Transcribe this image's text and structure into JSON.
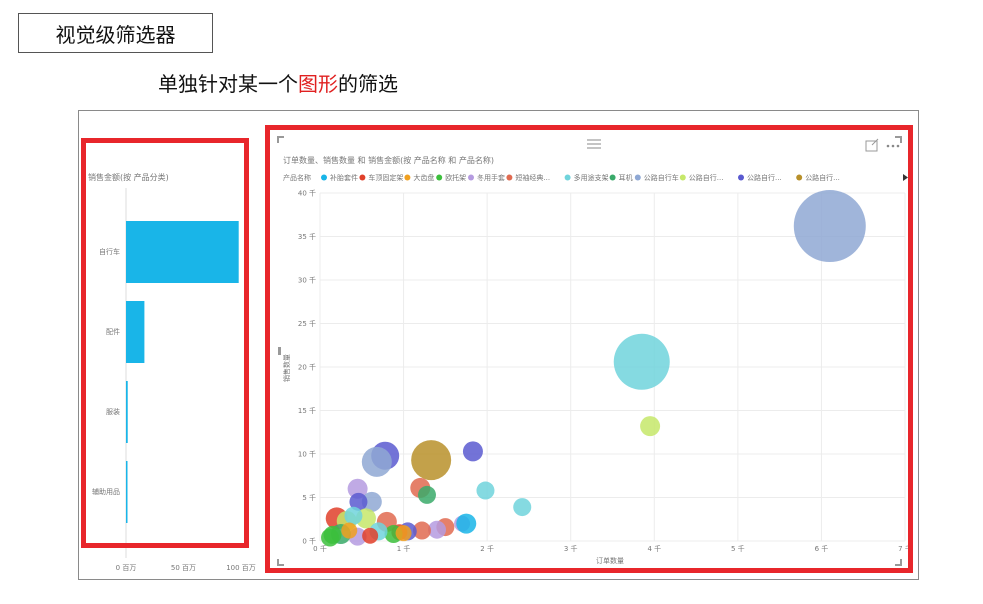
{
  "page": {
    "box_title": "视觉级筛选器",
    "subtitle_pre": "单独针对某一个",
    "subtitle_highlight": "图形",
    "subtitle_post": "的筛选"
  },
  "chart_data": [
    {
      "type": "bar",
      "orientation": "horizontal",
      "title": "销售金额(按 产品分类)",
      "categories": [
        "自行车",
        "配件",
        "服装",
        "辅助用品"
      ],
      "values": [
        98,
        16,
        1.5,
        1
      ],
      "xlim": [
        0,
        100
      ],
      "xticks": [
        {
          "v": 0,
          "label": "0 百万"
        },
        {
          "v": 50,
          "label": "50 百万"
        },
        {
          "v": 100,
          "label": "100 百万"
        }
      ],
      "color": "#19b5e8"
    },
    {
      "type": "scatter",
      "title": "订单数量、销售数量 和 销售金额(按 产品名称 和 产品名称)",
      "xlabel": "订单数量",
      "ylabel": "销售数量",
      "xlim": [
        0,
        7000
      ],
      "ylim": [
        0,
        40000
      ],
      "xticks": [
        {
          "v": 0,
          "label": "0 千"
        },
        {
          "v": 1000,
          "label": "1 千"
        },
        {
          "v": 2000,
          "label": "2 千"
        },
        {
          "v": 3000,
          "label": "3 千"
        },
        {
          "v": 4000,
          "label": "4 千"
        },
        {
          "v": 5000,
          "label": "5 千"
        },
        {
          "v": 6000,
          "label": "6 千"
        },
        {
          "v": 7000,
          "label": "7 千"
        }
      ],
      "yticks": [
        {
          "v": 0,
          "label": "0 千"
        },
        {
          "v": 5000,
          "label": "5 千"
        },
        {
          "v": 10000,
          "label": "10 千"
        },
        {
          "v": 15000,
          "label": "15 千"
        },
        {
          "v": 20000,
          "label": "20 千"
        },
        {
          "v": 25000,
          "label": "25 千"
        },
        {
          "v": 30000,
          "label": "30 千"
        },
        {
          "v": 35000,
          "label": "35 千"
        },
        {
          "v": 40000,
          "label": "40 千"
        }
      ],
      "legend_title": "产品名称",
      "legend": [
        {
          "name": "补胎套件",
          "color": "#19b5e8"
        },
        {
          "name": "车顶固定架",
          "color": "#e0402a"
        },
        {
          "name": "大齿盘",
          "color": "#f0a020"
        },
        {
          "name": "欧托架",
          "color": "#3cbf3c"
        },
        {
          "name": "冬用手套",
          "color": "#b59be0"
        },
        {
          "name": "短袖经典...",
          "color": "#e06a50"
        },
        {
          "name": "多用途支架",
          "color": "#70d4dc"
        },
        {
          "name": "耳机",
          "color": "#3aaa6a"
        },
        {
          "name": "公路自行车",
          "color": "#8fa8d4"
        },
        {
          "name": "公路自行...",
          "color": "#c6e86a"
        },
        {
          "name": "公路自行...",
          "color": "#5a5ad0"
        },
        {
          "name": "公路自行...",
          "color": "#b8902a"
        }
      ],
      "points": [
        {
          "x": 6100,
          "y": 36200,
          "size": 36,
          "color": "#8fa8d4"
        },
        {
          "x": 3850,
          "y": 20600,
          "size": 28,
          "color": "#70d4dc"
        },
        {
          "x": 3950,
          "y": 13200,
          "size": 10,
          "color": "#c6e86a"
        },
        {
          "x": 1330,
          "y": 9300,
          "size": 20,
          "color": "#b8902a"
        },
        {
          "x": 780,
          "y": 9800,
          "size": 14,
          "color": "#5a5ad0"
        },
        {
          "x": 680,
          "y": 9100,
          "size": 15,
          "color": "#8fa8d4"
        },
        {
          "x": 1830,
          "y": 10300,
          "size": 10,
          "color": "#5a5ad0"
        },
        {
          "x": 1200,
          "y": 6100,
          "size": 10,
          "color": "#e06a50"
        },
        {
          "x": 1280,
          "y": 5300,
          "size": 9,
          "color": "#3aaa6a"
        },
        {
          "x": 1980,
          "y": 5800,
          "size": 9,
          "color": "#70d4dc"
        },
        {
          "x": 2420,
          "y": 3900,
          "size": 9,
          "color": "#70d4dc"
        },
        {
          "x": 450,
          "y": 6000,
          "size": 10,
          "color": "#b59be0"
        },
        {
          "x": 620,
          "y": 4500,
          "size": 10,
          "color": "#8fa8d4"
        },
        {
          "x": 460,
          "y": 4500,
          "size": 9,
          "color": "#5a5ad0"
        },
        {
          "x": 200,
          "y": 2600,
          "size": 11,
          "color": "#e0402a"
        },
        {
          "x": 320,
          "y": 2300,
          "size": 10,
          "color": "#c6e86a"
        },
        {
          "x": 550,
          "y": 2600,
          "size": 10,
          "color": "#c6e86a"
        },
        {
          "x": 400,
          "y": 2900,
          "size": 9,
          "color": "#70d4dc"
        },
        {
          "x": 800,
          "y": 2200,
          "size": 10,
          "color": "#e06a50"
        },
        {
          "x": 1500,
          "y": 1600,
          "size": 9,
          "color": "#e06a50"
        },
        {
          "x": 1700,
          "y": 2000,
          "size": 8,
          "color": "#b59be0"
        },
        {
          "x": 1750,
          "y": 2000,
          "size": 10,
          "color": "#19b5e8"
        },
        {
          "x": 1400,
          "y": 1300,
          "size": 9,
          "color": "#b59be0"
        },
        {
          "x": 1220,
          "y": 1200,
          "size": 9,
          "color": "#e06a50"
        },
        {
          "x": 1050,
          "y": 1100,
          "size": 9,
          "color": "#5a5ad0"
        },
        {
          "x": 950,
          "y": 1000,
          "size": 8,
          "color": "#e0402a"
        },
        {
          "x": 880,
          "y": 800,
          "size": 9,
          "color": "#3cbf3c"
        },
        {
          "x": 1000,
          "y": 900,
          "size": 8,
          "color": "#f0a020"
        },
        {
          "x": 700,
          "y": 1100,
          "size": 9,
          "color": "#70d4dc"
        },
        {
          "x": 450,
          "y": 500,
          "size": 9,
          "color": "#b59be0"
        },
        {
          "x": 250,
          "y": 800,
          "size": 10,
          "color": "#3aaa6a"
        },
        {
          "x": 150,
          "y": 700,
          "size": 9,
          "color": "#3cbf3c"
        },
        {
          "x": 120,
          "y": 400,
          "size": 9,
          "color": "#3cbf3c"
        },
        {
          "x": 350,
          "y": 1200,
          "size": 8,
          "color": "#f0a020"
        },
        {
          "x": 600,
          "y": 600,
          "size": 8,
          "color": "#e0402a"
        }
      ]
    }
  ]
}
